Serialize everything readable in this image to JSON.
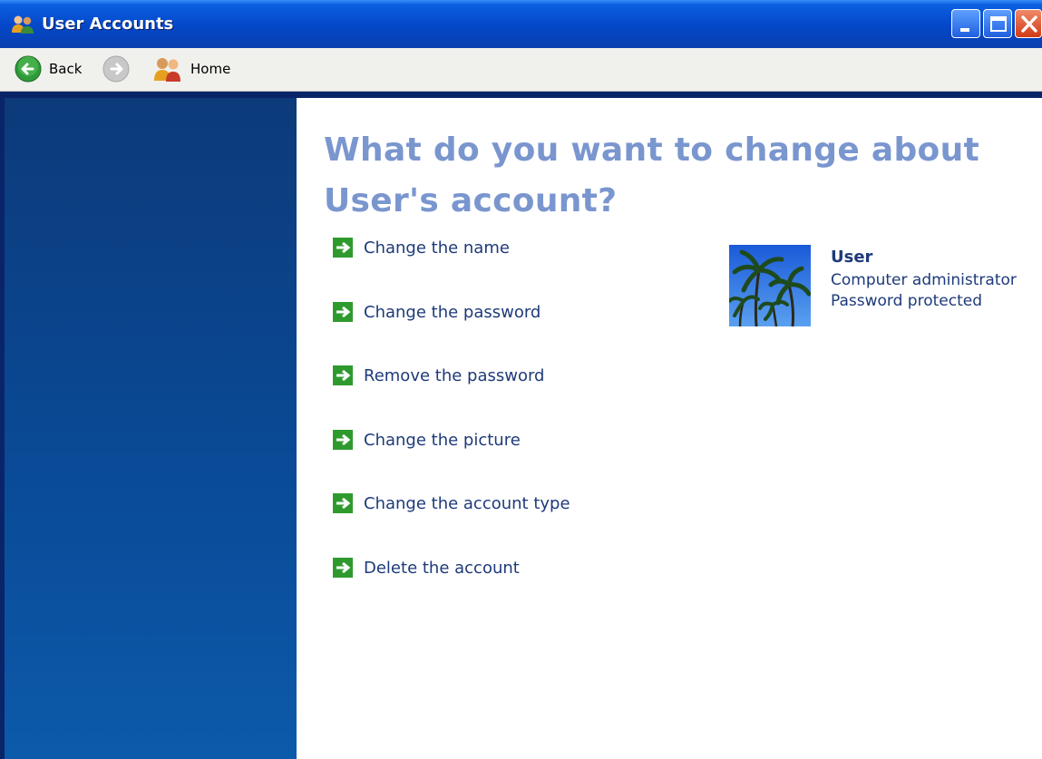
{
  "window": {
    "title": "User Accounts",
    "min_label": "",
    "max_label": "",
    "close_label": ""
  },
  "toolbar": {
    "back_label": "Back",
    "forward_label": "",
    "home_label": "Home"
  },
  "main": {
    "heading": "What do you want to change about User's account?",
    "tasks": [
      {
        "label": "Change the name"
      },
      {
        "label": "Change the password"
      },
      {
        "label": "Remove the password"
      },
      {
        "label": "Change the picture"
      },
      {
        "label": "Change the account type"
      },
      {
        "label": "Delete the account"
      }
    ]
  },
  "account": {
    "name": "User",
    "type": "Computer administrator",
    "status": "Password protected",
    "picture_icon": "palm-trees-picture"
  },
  "colors": {
    "heading": "#7a96cf",
    "link": "#1e3a7a",
    "sidebar": "#0a4a96",
    "task_arrow": "#2e9a2e"
  }
}
